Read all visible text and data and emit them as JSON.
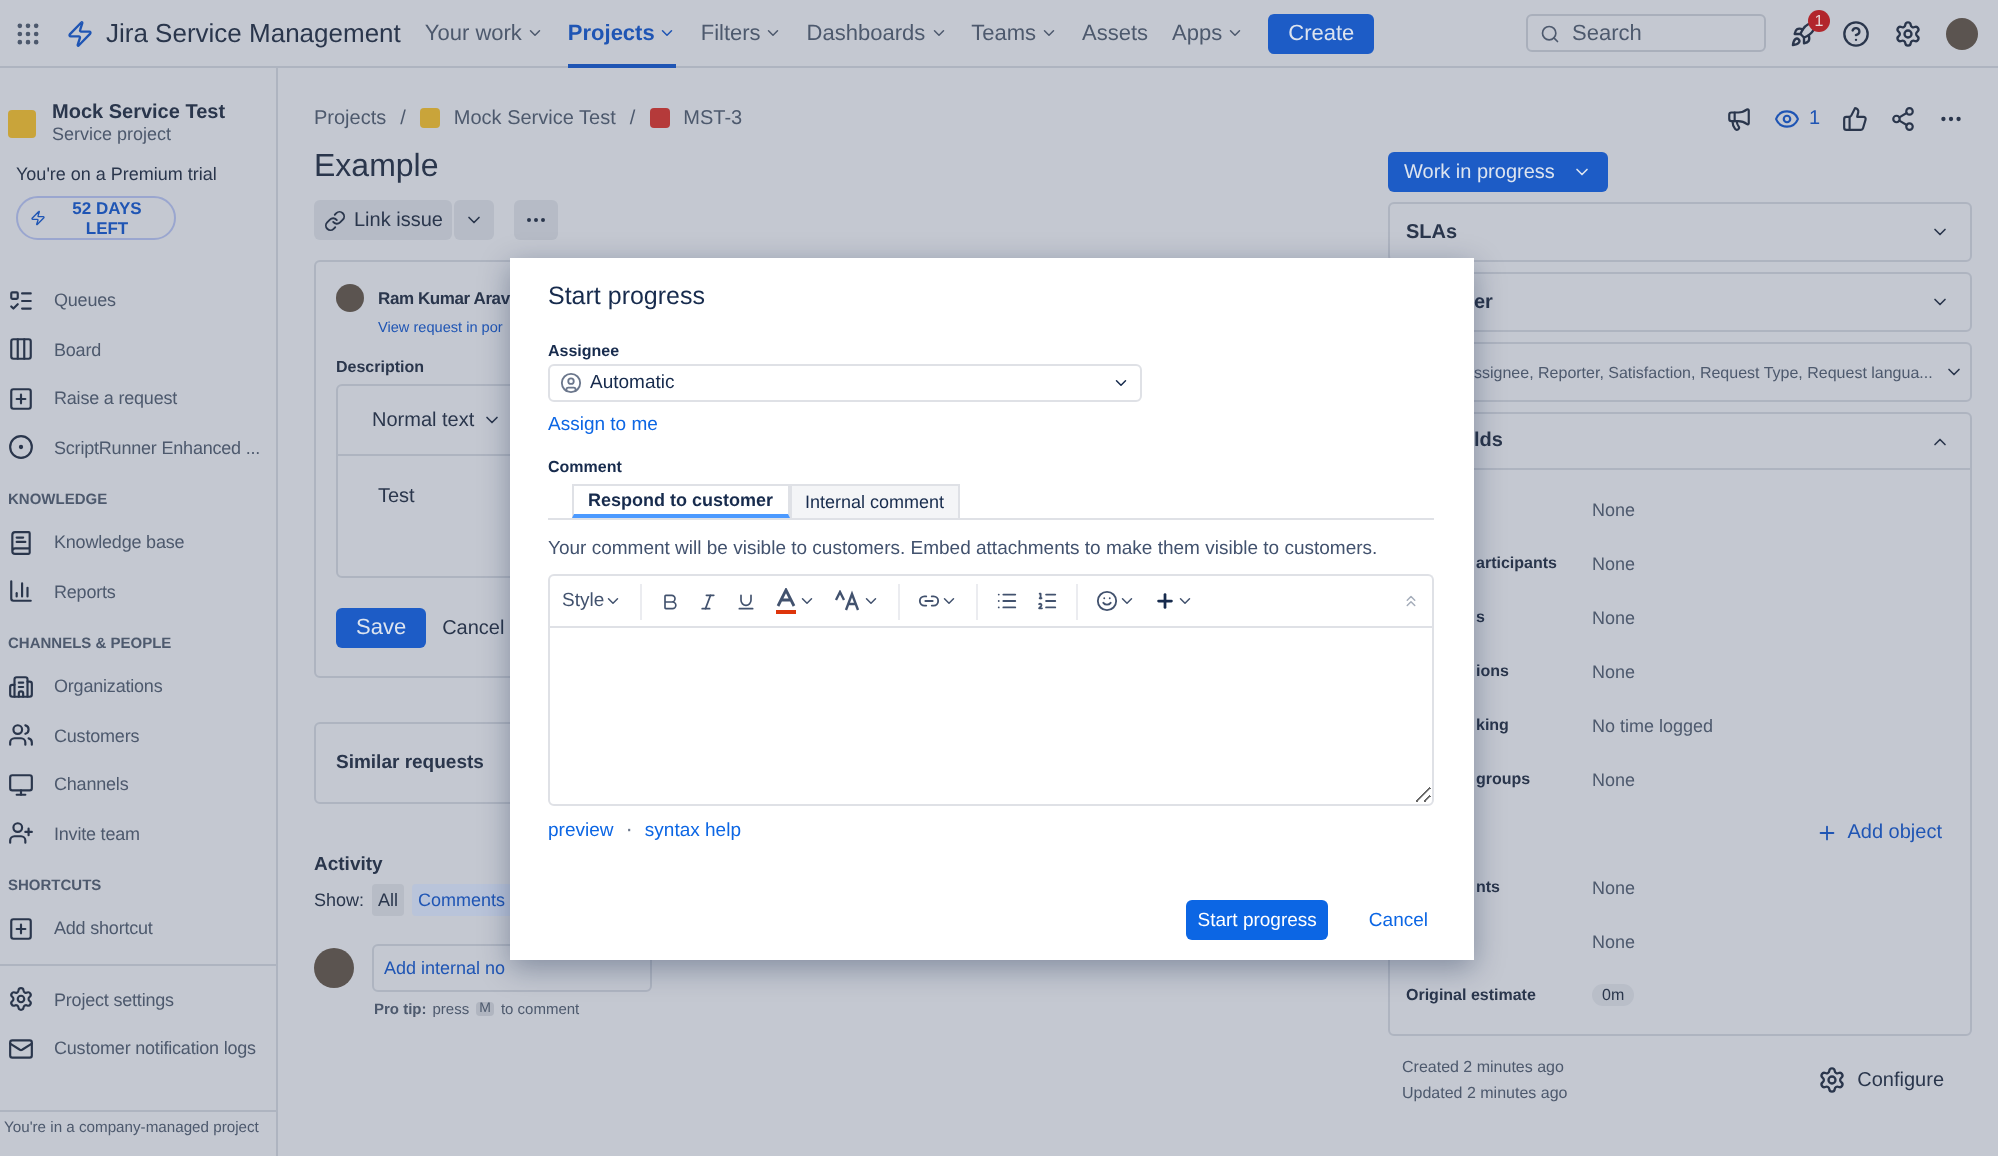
{
  "nav": {
    "app_name": "Jira Service Management",
    "menu": [
      {
        "label": "Your work",
        "selected": false,
        "has_menu": true
      },
      {
        "label": "Projects",
        "selected": true,
        "has_menu": true
      },
      {
        "label": "Filters",
        "selected": false,
        "has_menu": true
      },
      {
        "label": "Dashboards",
        "selected": false,
        "has_menu": true
      },
      {
        "label": "Teams",
        "selected": false,
        "has_menu": true
      },
      {
        "label": "Assets",
        "selected": false,
        "has_menu": false
      },
      {
        "label": "Apps",
        "selected": false,
        "has_menu": true
      }
    ],
    "create": "Create",
    "search": {
      "placeholder": "Search"
    },
    "notification_count": "1"
  },
  "sidebar": {
    "project": {
      "name": "Mock Service Test",
      "type": "Service project"
    },
    "trial_text": "You're on a Premium trial",
    "trial_button": "52 DAYS LEFT",
    "sections": [
      {
        "items": [
          "Queues",
          "Board",
          "Raise a request",
          "ScriptRunner Enhanced ..."
        ]
      },
      {
        "heading": "KNOWLEDGE",
        "items": [
          "Knowledge base",
          "Reports"
        ]
      },
      {
        "heading": "CHANNELS & PEOPLE",
        "items": [
          "Organizations",
          "Customers",
          "Channels",
          "Invite team"
        ]
      },
      {
        "heading": "SHORTCUTS",
        "items": [
          "Add shortcut"
        ]
      }
    ],
    "bottom_items": [
      "Project settings",
      "Customer notification logs"
    ],
    "footer": "You're in a company-managed project"
  },
  "breadcrumbs": [
    "Projects",
    "Mock Service Test",
    "MST-3"
  ],
  "breadcrumb_separator": "/",
  "issue": {
    "title": "Example",
    "link_button": "Link issue",
    "reporter": "Ram Kumar Arav",
    "portal_link": "View request in por",
    "description_label": "Description",
    "text_style": "Normal text",
    "description": "Test",
    "save": "Save",
    "cancel": "Cancel",
    "similar": "Similar requests"
  },
  "activity": {
    "heading": "Activity",
    "show_label": "Show:",
    "filters": [
      {
        "label": "All",
        "selected": false
      },
      {
        "label": "Comments",
        "selected": true
      }
    ],
    "note_placeholder": "Add internal no",
    "tip_label": "Pro tip:",
    "tip_before": "press",
    "tip_key": "M",
    "tip_after": "to comment"
  },
  "side": {
    "watchers": "1",
    "status": "Work in progress",
    "panels": [
      {
        "title": "SLAs",
        "expanded": false
      },
      {
        "title": "er",
        "expanded": false
      },
      {
        "title": "ssignee, Reporter, Satisfaction, Request Type, Request langua...",
        "expanded": false
      },
      {
        "title": "lds",
        "expanded": true
      }
    ],
    "fields": [
      {
        "kind": "text",
        "value": "None"
      },
      {
        "kind": "text",
        "label": "articipants",
        "value": "None"
      },
      {
        "kind": "text",
        "label": "s",
        "value": "None"
      },
      {
        "kind": "text",
        "label": "ions",
        "value": "None"
      },
      {
        "kind": "text",
        "label": "king",
        "value": "No time logged"
      },
      {
        "kind": "text",
        "label": "groups",
        "value": "None"
      },
      {
        "kind": "link",
        "value": "Add object"
      },
      {
        "kind": "text",
        "label": "nts",
        "value": "None"
      },
      {
        "kind": "text",
        "value": "None"
      },
      {
        "kind": "pill",
        "label": "Original estimate",
        "value": "0m"
      }
    ],
    "created": "Created 2 minutes ago",
    "updated": "Updated 2 minutes ago",
    "configure": "Configure"
  },
  "modal": {
    "title": "Start progress",
    "assignee_label": "Assignee",
    "assignee": "Automatic",
    "assign_to_me": "Assign to me",
    "comment_label": "Comment",
    "tabs": [
      {
        "label": "Respond to customer",
        "selected": true
      },
      {
        "label": "Internal comment",
        "selected": false
      }
    ],
    "notice": "Your comment will be visible to customers. Embed attachments to make them visible to customers.",
    "style_menu": "Style",
    "preview": "preview",
    "separator": "·",
    "syntax_help": "syntax help",
    "submit": "Start progress",
    "cancel": "Cancel"
  }
}
